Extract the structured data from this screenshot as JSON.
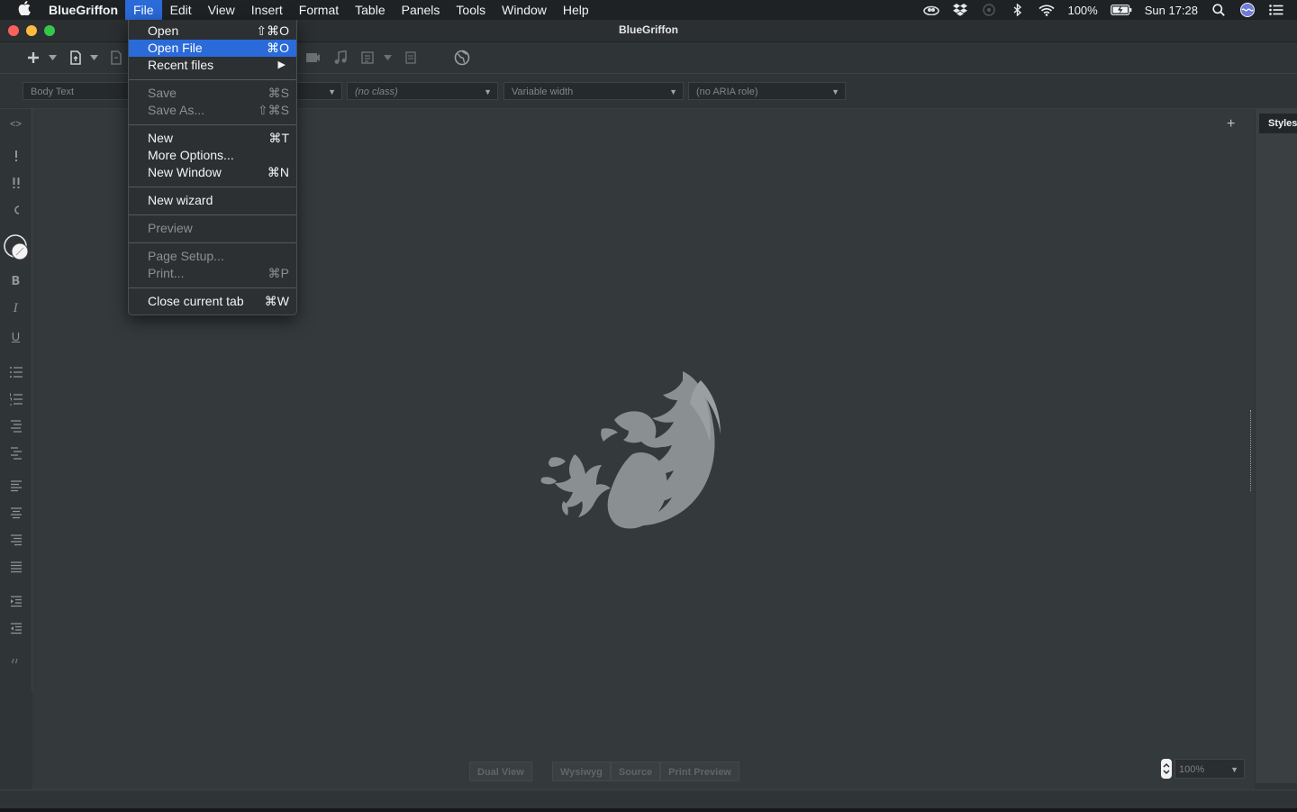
{
  "menubar": {
    "app_name": "BlueGriffon",
    "menus": [
      "File",
      "Edit",
      "View",
      "Insert",
      "Format",
      "Table",
      "Panels",
      "Tools",
      "Window",
      "Help"
    ],
    "battery": "100%",
    "clock": "Sun 17:28"
  },
  "window": {
    "title": "BlueGriffon"
  },
  "format_bar": {
    "paragraph": "Body Text",
    "class": "(no class)",
    "width": "Variable width",
    "aria": "(no ARIA role)"
  },
  "file_menu": {
    "items": [
      {
        "label": "Open",
        "shortcut": "⇧⌘O",
        "state": "enabled"
      },
      {
        "label": "Open File",
        "shortcut": "⌘O",
        "state": "highlighted"
      },
      {
        "label": "Recent files",
        "shortcut": "",
        "state": "submenu"
      },
      {
        "label": "Save",
        "shortcut": "⌘S",
        "state": "disabled"
      },
      {
        "label": "Save As...",
        "shortcut": "⇧⌘S",
        "state": "disabled"
      },
      {
        "label": "New",
        "shortcut": "⌘T",
        "state": "enabled"
      },
      {
        "label": "More Options...",
        "shortcut": "",
        "state": "enabled"
      },
      {
        "label": "New Window",
        "shortcut": "⌘N",
        "state": "enabled"
      },
      {
        "label": "New wizard",
        "shortcut": "",
        "state": "enabled"
      },
      {
        "label": "Preview",
        "shortcut": "",
        "state": "disabled"
      },
      {
        "label": "Page Setup...",
        "shortcut": "",
        "state": "disabled"
      },
      {
        "label": "Print...",
        "shortcut": "⌘P",
        "state": "disabled"
      },
      {
        "label": "Close current tab",
        "shortcut": "⌘W",
        "state": "enabled"
      }
    ]
  },
  "sidebar": {
    "source_toggle": "<>",
    "bold": "B",
    "italic": "I",
    "underline": "U"
  },
  "view_tabs": {
    "dual": "Dual View",
    "wysiwyg": "Wysiwyg",
    "source": "Source",
    "print_preview": "Print Preview"
  },
  "zoom": {
    "value": "100%"
  },
  "right_panel": {
    "tab_label": "Styles",
    "add": "+"
  }
}
